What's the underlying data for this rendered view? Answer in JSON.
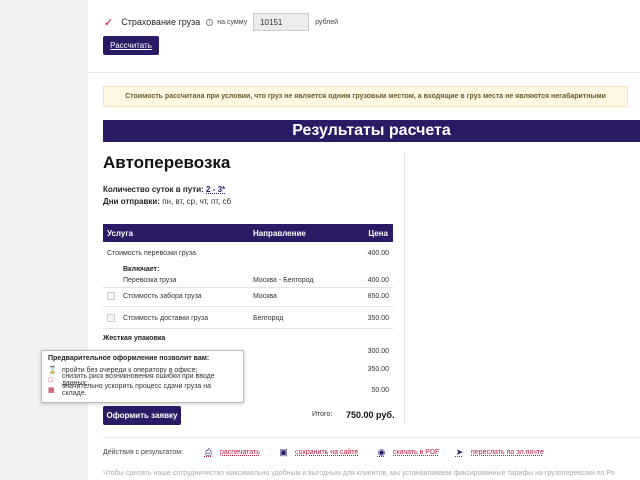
{
  "insurance": {
    "checked": true,
    "label": "Страхование груза",
    "sum_label": "на сумму",
    "value": "10151",
    "unit": "рублей"
  },
  "calculate_label": "Рассчитать",
  "note": "Стоимость рассчитана при условии, что груз не является одним грузовым местом, а входящие в груз места не являются негабаритными",
  "results_title": "Результаты расчета",
  "section_title": "Автоперевозка",
  "transit": {
    "label": "Количество суток в пути:",
    "value": "2 - 3*"
  },
  "ship_days": {
    "label": "Дни отправки:",
    "value": "пн, вт, ср, чт, пт, сб"
  },
  "table": {
    "headers": [
      "Услуга",
      "Направление",
      "Цена"
    ],
    "rows": [
      {
        "service": "Стоимость перевозки груза",
        "direction": "",
        "price": "400.00"
      },
      {
        "service": "Перевозка груза",
        "direction": "Москва - Белгород",
        "price": "400.00"
      },
      {
        "service": "Стоимость забора груза",
        "direction": "Москва",
        "price": "850.00"
      },
      {
        "service": "Стоимость доставки груза",
        "direction": "Белгород",
        "price": "350.00"
      }
    ],
    "includes_label": "Включает:",
    "extra_title": "Жесткая упаковка",
    "extra_prices": [
      "300.00",
      "350.00",
      "50.00"
    ]
  },
  "tooltip": {
    "title": "Предварительное оформление позволит вам:",
    "items": [
      "пройти без очереди к оператору в офисе;",
      "снизить риск возникновения ошибки при вводе данных;",
      "значительно ускорить процесс сдачи груза на складе."
    ]
  },
  "order_label": "Оформить заявку",
  "total": {
    "label": "Итого:",
    "value": "750.00 руб."
  },
  "actions": {
    "label": "Действия с результатом:",
    "print": "распечатать",
    "save": "сохранить на сайте",
    "pdf": "скачать в PDF",
    "email": "переслать по эл.почте"
  },
  "footer": "Чтобы сделать наше сотрудничество максимально удобным и выгодным для клиентов, мы устанавливаем фиксированные тарифы на грузоперевозки по Ро"
}
